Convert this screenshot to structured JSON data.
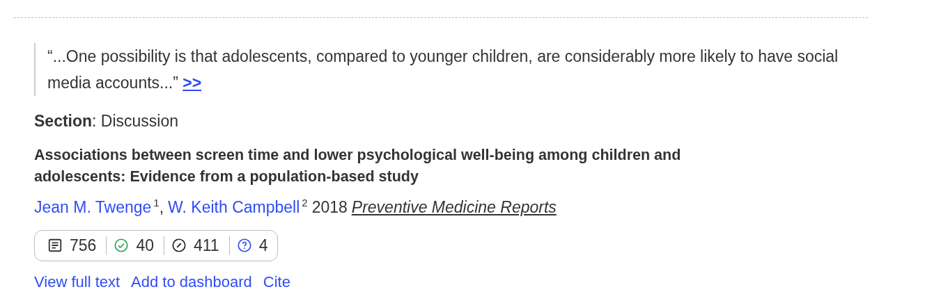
{
  "quote": {
    "text": "“...One possibility is that adolescents, compared to younger children, are considerably more likely to have social media accounts...”",
    "link": ">>"
  },
  "section": {
    "label": "Section",
    "value": ": Discussion"
  },
  "paper": {
    "title": "Associations between screen time and lower psychological well-being among children and adolescents: Evidence from a population-based study",
    "authors": [
      {
        "name": "Jean M. Twenge",
        "sup": "1"
      },
      {
        "name": "W. Keith Campbell",
        "sup": "2"
      }
    ],
    "author_separator": ",",
    "year": "2018",
    "journal": "Preventive Medicine Reports"
  },
  "stats": [
    {
      "kind": "publications",
      "count": "756",
      "color": "#333333"
    },
    {
      "kind": "supporting",
      "count": "40",
      "color": "#2e9e55"
    },
    {
      "kind": "mentioning",
      "count": "411",
      "color": "#222222"
    },
    {
      "kind": "unclassified",
      "count": "4",
      "color": "#2f4cf5"
    }
  ],
  "actions": [
    "View full text",
    "Add to dashboard",
    "Cite"
  ]
}
